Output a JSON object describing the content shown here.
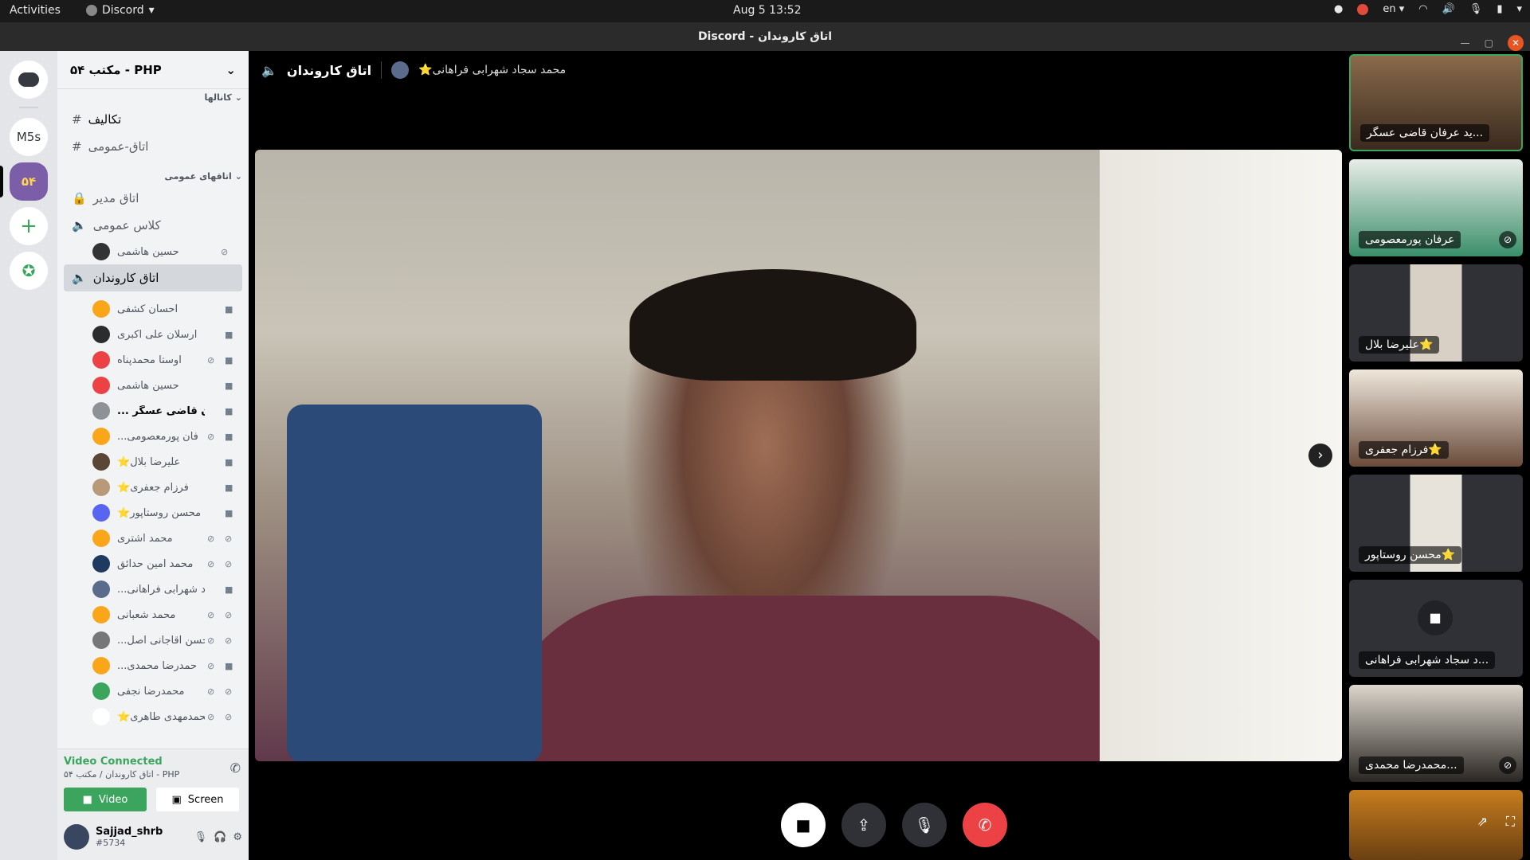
{
  "topbar": {
    "activities": "Activities",
    "app": "Discord",
    "clock": "Aug 5  13:52",
    "lang": "en"
  },
  "window": {
    "title": "Discord - اتاق کاروندان"
  },
  "guilds": [
    {
      "label": "M5s"
    },
    {
      "label": "۵۴"
    }
  ],
  "server": {
    "name": "مکتب ۵۴ - PHP"
  },
  "categories": {
    "text": "کانالها",
    "voice": "اتاقهای عمومی"
  },
  "text_channels": [
    {
      "name": "تکالیف"
    },
    {
      "name": "اتاق-عمومی"
    }
  ],
  "voice_channels": [
    {
      "name": "اتاق مدیر"
    },
    {
      "name": "کلاس عمومی"
    }
  ],
  "class_user": "حسین هاشمی",
  "current_channel": "اتاق کاروندان",
  "members": [
    {
      "name": "احسان کشفی",
      "muted": false,
      "cam": true,
      "color": "#faa61a"
    },
    {
      "name": "ارسلان علی اکبری",
      "muted": false,
      "cam": true,
      "color": "#2c2c2c"
    },
    {
      "name": "اوستا محمدپناه",
      "muted": true,
      "cam": true,
      "color": "#ed4245"
    },
    {
      "name": "حسین هاشمی",
      "muted": false,
      "cam": true,
      "color": "#ed4245"
    },
    {
      "name": "... عرفان قاضی عسگر",
      "muted": false,
      "cam": true,
      "color": "#8e9297",
      "bold": true
    },
    {
      "name": "...فان پورمعصومی",
      "muted": true,
      "cam": true,
      "color": "#faa61a"
    },
    {
      "name": "⭐علیرضا بلال",
      "muted": false,
      "cam": true,
      "color": "#5a4636"
    },
    {
      "name": "⭐فرزام جعفری",
      "muted": false,
      "cam": true,
      "color": "#b89a7a"
    },
    {
      "name": "⭐محسن روستاپور",
      "muted": false,
      "cam": true,
      "color": "#5865f2"
    },
    {
      "name": "محمد اشتری",
      "muted": true,
      "cam": false,
      "color": "#faa61a"
    },
    {
      "name": "محمد امین حدائق",
      "muted": true,
      "cam": false,
      "color": "#1e3a5f"
    },
    {
      "name": "...جاد شهرابی فراهانی",
      "muted": false,
      "cam": true,
      "color": "#5b6b8c"
    },
    {
      "name": "محمد شعبانی",
      "muted": true,
      "cam": false,
      "color": "#faa61a"
    },
    {
      "name": "...محسن آقاجانی اصل",
      "muted": true,
      "cam": false,
      "color": "#777"
    },
    {
      "name": "...حمدرضا محمدی",
      "muted": true,
      "cam": true,
      "color": "#faa61a"
    },
    {
      "name": "محمدرضا نجفی",
      "muted": true,
      "cam": false,
      "color": "#3ba55d"
    },
    {
      "name": "⭐محمدمهدی طاهری",
      "muted": true,
      "cam": false,
      "color": "#fff"
    }
  ],
  "voice": {
    "status": "Video Connected",
    "location": "اتاق کاروندان / مکتب ۵۴ - PHP",
    "video_btn": "Video",
    "screen_btn": "Screen"
  },
  "user": {
    "name": "Sajjad_shrb",
    "tag": "#5734"
  },
  "stage": {
    "channel": "اتاق کاروندان",
    "speaker": "⭐محمد سجاد شهرابی فراهانی"
  },
  "tiles": [
    {
      "name": "...ید عرفان قاضی عسگر"
    },
    {
      "name": "عرفان پورمعصومی"
    },
    {
      "name": "⭐علیرضا بلال"
    },
    {
      "name": "⭐فرزام جعفری"
    },
    {
      "name": "⭐محسن روستاپور"
    },
    {
      "name": "...د سجاد شهرابی فراهانی"
    },
    {
      "name": "...محمدرضا محمدی"
    }
  ],
  "colors": {
    "accent": "#5865f2",
    "green": "#3ba55d",
    "red": "#ed4245"
  }
}
